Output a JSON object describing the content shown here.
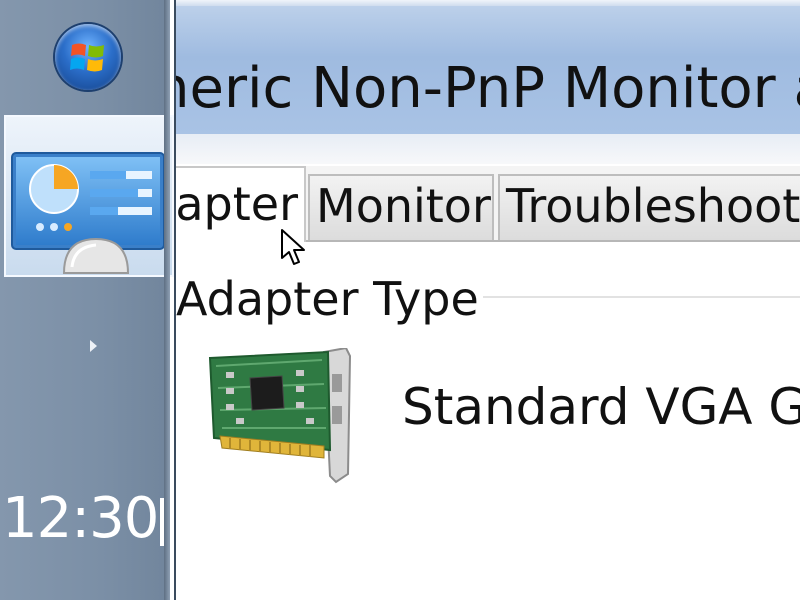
{
  "taskbar": {
    "start_icon": "windows-start-orb",
    "pinned_icon": "control-panel-icon",
    "tray_icon": "show-hidden-icons-arrow",
    "clock": "12:30"
  },
  "window": {
    "title": "neric Non-PnP Monitor a",
    "tabs": [
      {
        "label": "apter",
        "active": true
      },
      {
        "label": "Monitor",
        "active": false
      },
      {
        "label": "Troubleshoot",
        "active": false
      }
    ],
    "adapter_group_label": "Adapter Type",
    "adapter_name": "Standard VGA Gr",
    "adapter_icon": "graphics-card-icon"
  },
  "cursor_icon": "mouse-pointer-icon"
}
